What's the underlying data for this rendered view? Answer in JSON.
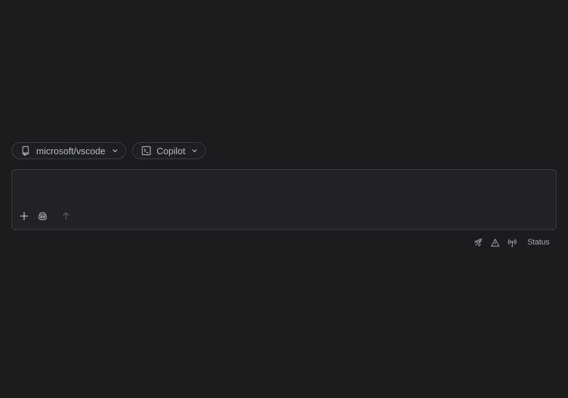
{
  "selectors": {
    "repo": {
      "label": "microsoft/vscode",
      "icon": "repo-icon"
    },
    "agent": {
      "label": "Copilot",
      "icon": "terminal-icon"
    }
  },
  "composer": {
    "placeholder": "",
    "value": "",
    "tools": [
      "plus-icon",
      "copilot-icon",
      "send-arrow-icon"
    ]
  },
  "status_bar": {
    "icons": [
      "rocket-icon",
      "warning-icon",
      "broadcast-icon"
    ],
    "status_label": "Status"
  },
  "colors": {
    "background": "#1b1c1e",
    "panel": "#222326",
    "border": "#3a3c40",
    "text": "#b9bcc1"
  }
}
